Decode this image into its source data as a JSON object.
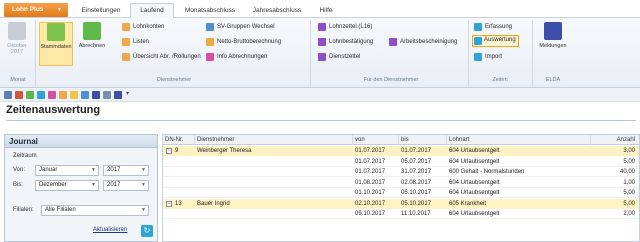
{
  "app_button": "Lohn Plus",
  "tabs": [
    "Einstellungen",
    "Laufend",
    "Monatsabschluss",
    "Jahresabschluss",
    "Hilfe"
  ],
  "active_tab": "Laufend",
  "ribbon": {
    "monat_group": {
      "button": "Oktober 2017",
      "label": "Monat"
    },
    "dn_group": {
      "label": "Dienstnehmer",
      "big": [
        "Stammdaten",
        "Abrechnen"
      ],
      "col1": [
        "Lohnkonten",
        "Listen",
        "Übersicht Abr. /Rollungen"
      ],
      "col2": [
        "SV-Gruppen Wechsel",
        "Netto-Bruttoberechnung",
        "Info Abrechnungen"
      ]
    },
    "fdn_group": {
      "label": "Für den Dienstnehmer",
      "items": [
        "Lohnzettel (L16)",
        "Lohnbestätigung",
        "Arbeitsbescheinigung",
        "Dienstzettel"
      ]
    },
    "zeiten_group": {
      "label": "Zeiten",
      "items": [
        "Erfassung",
        "Auswertung",
        "Import"
      ]
    },
    "elda_group": {
      "label": "ELDA",
      "button": "Meldungen"
    }
  },
  "colors": {
    "accent_orange": "#e8891f",
    "selection_yellow": "#fde8a6",
    "group_row": "#fdf2c4",
    "link_blue": "#1f3c73"
  },
  "page_title": "Zeitenauswertung",
  "journal": {
    "title": "Journal",
    "zeitraum_label": "Zeitraum",
    "von_label": "Von:",
    "von_month": "Januar",
    "von_year": "2017",
    "bis_label": "Bis:",
    "bis_month": "Dezember",
    "bis_year": "2017",
    "filialen_label": "Filialen:",
    "filialen_value": "Alle Filialen",
    "refresh_label": "Aktualisieren"
  },
  "grid": {
    "headers": [
      "DN-Nr.",
      "Dienstnehmer",
      "von",
      "bis",
      "Lohnart",
      "Anzahl"
    ],
    "rows": [
      {
        "type": "group",
        "nr": "9",
        "name": "Weinberger Theresa",
        "von": "01.07.2017",
        "bis": "01.07.2017",
        "lohnart": "604 Urlaubsentgelt",
        "anzahl": "3,00"
      },
      {
        "type": "sub",
        "nr": "",
        "name": "",
        "von": "01.07.2017",
        "bis": "05.07.2017",
        "lohnart": "604 Urlaubsentgelt",
        "anzahl": "5,00"
      },
      {
        "type": "sub",
        "nr": "",
        "name": "",
        "von": "01.07.2017",
        "bis": "31.07.2017",
        "lohnart": "600 Gehalt - Normalstunden",
        "anzahl": "40,00"
      },
      {
        "type": "sub",
        "nr": "",
        "name": "",
        "von": "01.08.2017",
        "bis": "02.08.2017",
        "lohnart": "604 Urlaubsentgelt",
        "anzahl": "1,00"
      },
      {
        "type": "sub",
        "nr": "",
        "name": "",
        "von": "01.10.2017",
        "bis": "05.10.2017",
        "lohnart": "604 Urlaubsentgelt",
        "anzahl": "5,00"
      },
      {
        "type": "group",
        "nr": "13",
        "name": "Bauer Ingrid",
        "von": "02.10.2017",
        "bis": "05.10.2017",
        "lohnart": "605 Krankheit",
        "anzahl": "5,00"
      },
      {
        "type": "sub",
        "nr": "",
        "name": "",
        "von": "09.10.2017",
        "bis": "11.10.2017",
        "lohnart": "604 Urlaubsentgelt",
        "anzahl": "2,00"
      }
    ]
  }
}
